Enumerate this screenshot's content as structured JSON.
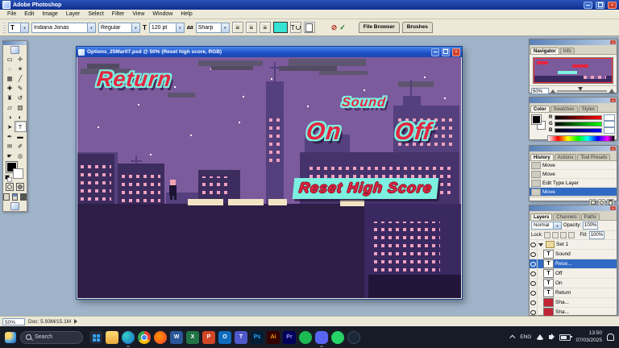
{
  "app": {
    "title": "Adobe Photoshop",
    "menus": [
      "File",
      "Edit",
      "Image",
      "Layer",
      "Select",
      "Filter",
      "View",
      "Window",
      "Help"
    ]
  },
  "options": {
    "tool_abbr": "T",
    "font_family": "Indiana Jonas",
    "font_style": "Regular",
    "size_icon": "T",
    "font_size": "120 pt",
    "aa_icon": "aa",
    "anti_alias": "Sharp",
    "well_tabs": [
      "File Browser",
      "Brushes"
    ]
  },
  "icons": {
    "dropdown": "▼",
    "close": "×",
    "align": "≡",
    "cancel": "⊘",
    "check": "✓",
    "type_thumb": "T",
    "fx": "ƒ",
    "adjustment": "◐",
    "status_arrow": ""
  },
  "toolbox": {
    "tools": [
      {
        "name": "rectangular-marquee-tool",
        "glyph": "▭"
      },
      {
        "name": "move-tool",
        "glyph": "✛"
      },
      {
        "name": "lasso-tool",
        "glyph": "◌"
      },
      {
        "name": "magic-wand-tool",
        "glyph": "✶"
      },
      {
        "name": "crop-tool",
        "glyph": "▦"
      },
      {
        "name": "slice-tool",
        "glyph": "╱"
      },
      {
        "name": "healing-brush-tool",
        "glyph": "✚"
      },
      {
        "name": "brush-tool",
        "glyph": "✎"
      },
      {
        "name": "clone-stamp-tool",
        "glyph": "♜"
      },
      {
        "name": "history-brush-tool",
        "glyph": "↺"
      },
      {
        "name": "eraser-tool",
        "glyph": "▱"
      },
      {
        "name": "gradient-tool",
        "glyph": "▨"
      },
      {
        "name": "blur-tool",
        "glyph": "◑"
      },
      {
        "name": "dodge-tool",
        "glyph": "◐"
      },
      {
        "name": "path-selection-tool",
        "glyph": "➤"
      },
      {
        "name": "type-tool",
        "glyph": "T"
      },
      {
        "name": "pen-tool",
        "glyph": "✒"
      },
      {
        "name": "shape-tool",
        "glyph": "▬"
      },
      {
        "name": "notes-tool",
        "glyph": "✉"
      },
      {
        "name": "eyedropper-tool",
        "glyph": "✐"
      },
      {
        "name": "hand-tool",
        "glyph": "☛"
      },
      {
        "name": "zoom-tool",
        "glyph": "◎"
      }
    ]
  },
  "document": {
    "title": "Options_25Mar07.psd @ 50% (Reset high score, RGB)",
    "canvas": {
      "return": "Return",
      "sound": "Sound",
      "on": "On",
      "off": "Off",
      "reset": "Reset High Score"
    }
  },
  "panels": {
    "navigator": {
      "tabs": [
        "Navigator",
        "Info"
      ],
      "zoom": "50%"
    },
    "color": {
      "tabs": [
        "Color",
        "Swatches",
        "Styles"
      ],
      "channels": [
        "R",
        "G",
        "B"
      ]
    },
    "history": {
      "tabs": [
        "History",
        "Actions",
        "Tool Presets"
      ],
      "states": [
        "Move",
        "Move",
        "Edit Type Layer",
        "Move"
      ]
    },
    "layers": {
      "tabs": [
        "Layers",
        "Channels",
        "Paths"
      ],
      "blend_mode": "Normal",
      "opacity_label": "Opacity:",
      "opacity": "100%",
      "lock_label": "Lock:",
      "fill_label": "Fill:",
      "fill": "100%",
      "items": [
        {
          "label": "Set 1"
        },
        {
          "label": "Sound"
        },
        {
          "label": "Rese..."
        },
        {
          "label": "Off"
        },
        {
          "label": "On"
        },
        {
          "label": "Return"
        },
        {
          "label": "Sha..."
        },
        {
          "label": "Sha..."
        }
      ]
    }
  },
  "statusbar": {
    "zoom": "50%",
    "doc": "Doc: 5.93M/15.1M"
  },
  "taskbar": {
    "search": "Search",
    "apps": [
      {
        "name": "start",
        "label": ""
      },
      {
        "name": "file-explorer",
        "label": ""
      },
      {
        "name": "edge",
        "label": ""
      },
      {
        "name": "chrome",
        "label": ""
      },
      {
        "name": "firefox",
        "label": ""
      },
      {
        "name": "word",
        "label": "W"
      },
      {
        "name": "excel",
        "label": "X"
      },
      {
        "name": "powerpoint",
        "label": "P"
      },
      {
        "name": "outlook",
        "label": "O"
      },
      {
        "name": "teams",
        "label": "T"
      },
      {
        "name": "photoshop",
        "label": "Ps"
      },
      {
        "name": "illustrator",
        "label": "Ai"
      },
      {
        "name": "premiere",
        "label": "Pr"
      },
      {
        "name": "spotify",
        "label": ""
      },
      {
        "name": "discord",
        "label": ""
      },
      {
        "name": "whatsapp",
        "label": ""
      },
      {
        "name": "steam",
        "label": ""
      }
    ],
    "tray": {
      "lang": "ENG",
      "time": "13:50",
      "date": "07/03/2025"
    }
  },
  "colors": {
    "selection_blue": "#316ac5",
    "canvas_purple": "#7c5b9d",
    "game_text_red": "#e6253f",
    "game_outline_cyan": "#7df0e0",
    "type_color_swatch": "#35e3d2",
    "taskbar_bg": "#171b26"
  }
}
